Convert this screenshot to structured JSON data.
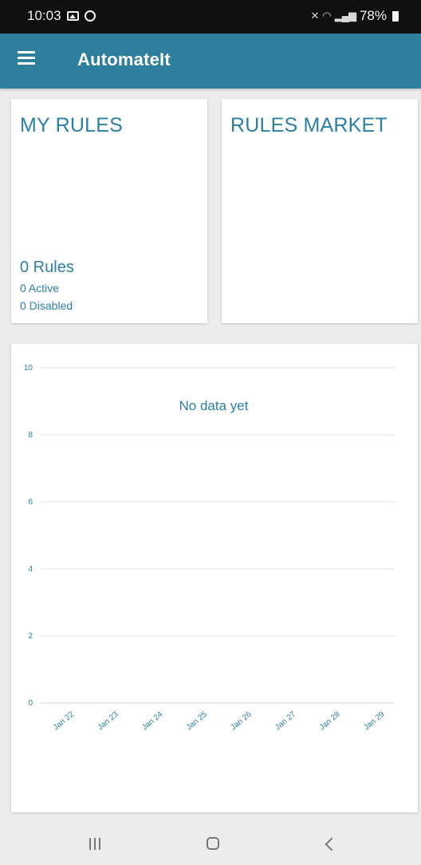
{
  "status_bar": {
    "time": "10:03",
    "battery_percent": "78%",
    "icons": [
      "gallery-icon",
      "clock-icon",
      "mute-icon",
      "wifi-icon",
      "signal-icon",
      "battery-icon"
    ]
  },
  "app_bar": {
    "title": "AutomateIt",
    "menu_icon": "hamburger-menu-icon"
  },
  "cards": {
    "my_rules": {
      "title": "MY RULES",
      "count": "0 Rules",
      "active": "0 Active",
      "disabled": "0 Disabled"
    },
    "rules_market": {
      "title": "RULES MARKET"
    }
  },
  "chart_data": {
    "type": "line",
    "message": "No data yet",
    "x_tick_labels": [
      "Jan 22",
      "Jan 23",
      "Jan 24",
      "Jan 25",
      "Jan 26",
      "Jan 27",
      "Jan 28",
      "Jan 29"
    ],
    "y_tick_labels": [
      "0",
      "2",
      "4",
      "6",
      "8",
      "10"
    ],
    "ylim": [
      0,
      10
    ],
    "series": [],
    "grid": true
  },
  "colors": {
    "app_bar": "#2e7f9e",
    "accent_text": "#2c7fa6",
    "background": "#ececec"
  },
  "nav_bar": {
    "icons": [
      "recents-icon",
      "home-icon",
      "back-icon"
    ]
  }
}
